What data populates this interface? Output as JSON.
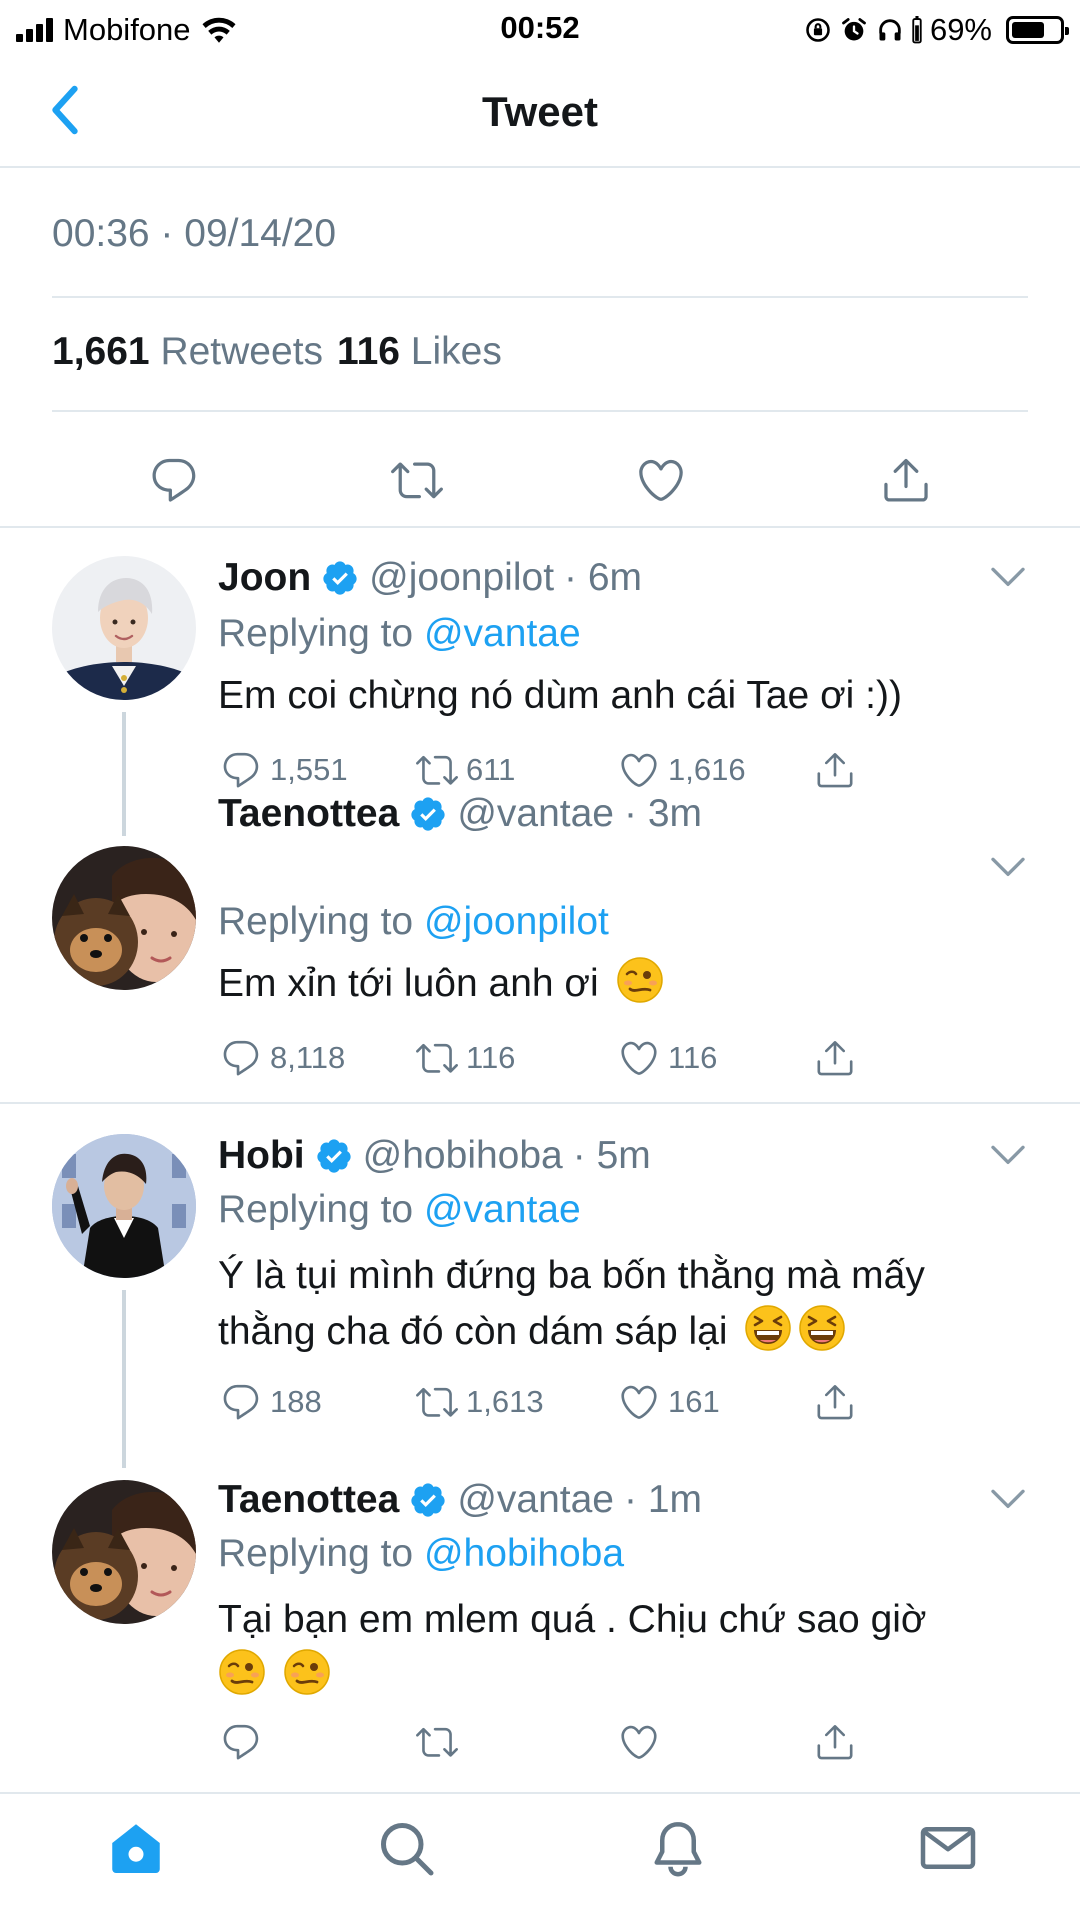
{
  "status": {
    "carrier": "Mobifone",
    "time": "00:52",
    "battery": "69%",
    "battery_level": 0.69
  },
  "nav": {
    "title": "Tweet"
  },
  "tweet_meta": {
    "timestamp": "00:36 · 09/14/20",
    "retweet_count": "1,661",
    "retweet_label": "Retweets",
    "like_count": "116",
    "like_label": "Likes"
  },
  "replies": [
    {
      "name": "Joon",
      "handle": "@joonpilot",
      "time": "· 6m",
      "replying_label": "Replying to",
      "replying_to": "@vantae",
      "text": "Em coi chừng nó dùm anh cái Tae ơi :))",
      "comments": "1,551",
      "retweets": "611",
      "likes": "1,616"
    },
    {
      "name": "Taenottea",
      "handle": "@vantae",
      "time": "· 3m",
      "replying_label": "Replying to",
      "replying_to": "@joonpilot",
      "text": "Em xỉn tới luôn anh ơi",
      "comments": "8,118",
      "retweets": "116",
      "likes": "116"
    },
    {
      "name": "Hobi",
      "handle": "@hobihoba",
      "time": "· 5m",
      "replying_label": "Replying to",
      "replying_to": "@vantae",
      "text": "Ý là tụi mình đứng ba bốn thằng mà mấy thằng cha đó còn dám sáp lại",
      "comments": "188",
      "retweets": "1,613",
      "likes": "161"
    },
    {
      "name": "Taenottea",
      "handle": "@vantae",
      "time": "· 1m",
      "replying_label": "Replying to",
      "replying_to": "@hobihoba",
      "text": "Tại bạn em mlem quá . Chịu chứ sao giờ",
      "comments": "",
      "retweets": "",
      "likes": ""
    }
  ],
  "icons": {
    "reply": "comment-icon",
    "retweet": "retweet-icon",
    "like": "heart-icon",
    "share": "share-icon",
    "verified": "verified-badge-icon",
    "emoji_woozy": "woozy-face-emoji",
    "emoji_laugh": "grinning-squinting-face-emoji",
    "tabs": [
      "home-icon",
      "search-icon",
      "notifications-icon",
      "messages-icon"
    ]
  },
  "colors": {
    "accent": "#1da1f2",
    "text": "#14171a",
    "secondary": "#657786",
    "divider": "#e1e8ed"
  }
}
